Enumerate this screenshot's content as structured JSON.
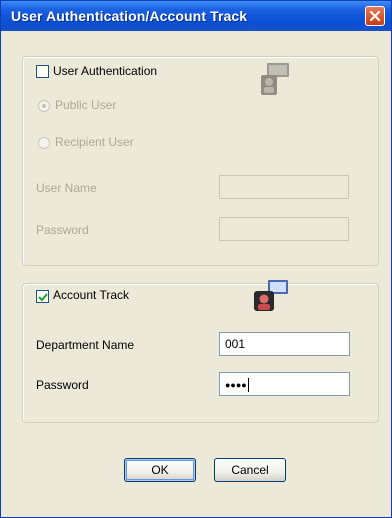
{
  "window": {
    "title": "User Authentication/Account Track"
  },
  "user_authentication": {
    "checkbox_label": "User Authentication",
    "checked": false,
    "radio_public_label": "Public User",
    "radio_recipient_label": "Recipient User",
    "user_name_label": "User Name",
    "password_label": "Password",
    "user_name_value": "",
    "password_value": "",
    "icon": "user-server-icon"
  },
  "account_track": {
    "checkbox_label": "Account Track",
    "checked": true,
    "department_name_label": "Department Name",
    "department_name_value": "001",
    "password_label": "Password",
    "password_value": "●●●●",
    "icon": "account-user-icon"
  },
  "buttons": {
    "ok_label": "OK",
    "cancel_label": "Cancel"
  },
  "colors": {
    "titlebar": "#0b4fd6",
    "dialog_bg": "#ece9d8",
    "close_button": "#c73b15",
    "disabled_text": "#aca899"
  }
}
